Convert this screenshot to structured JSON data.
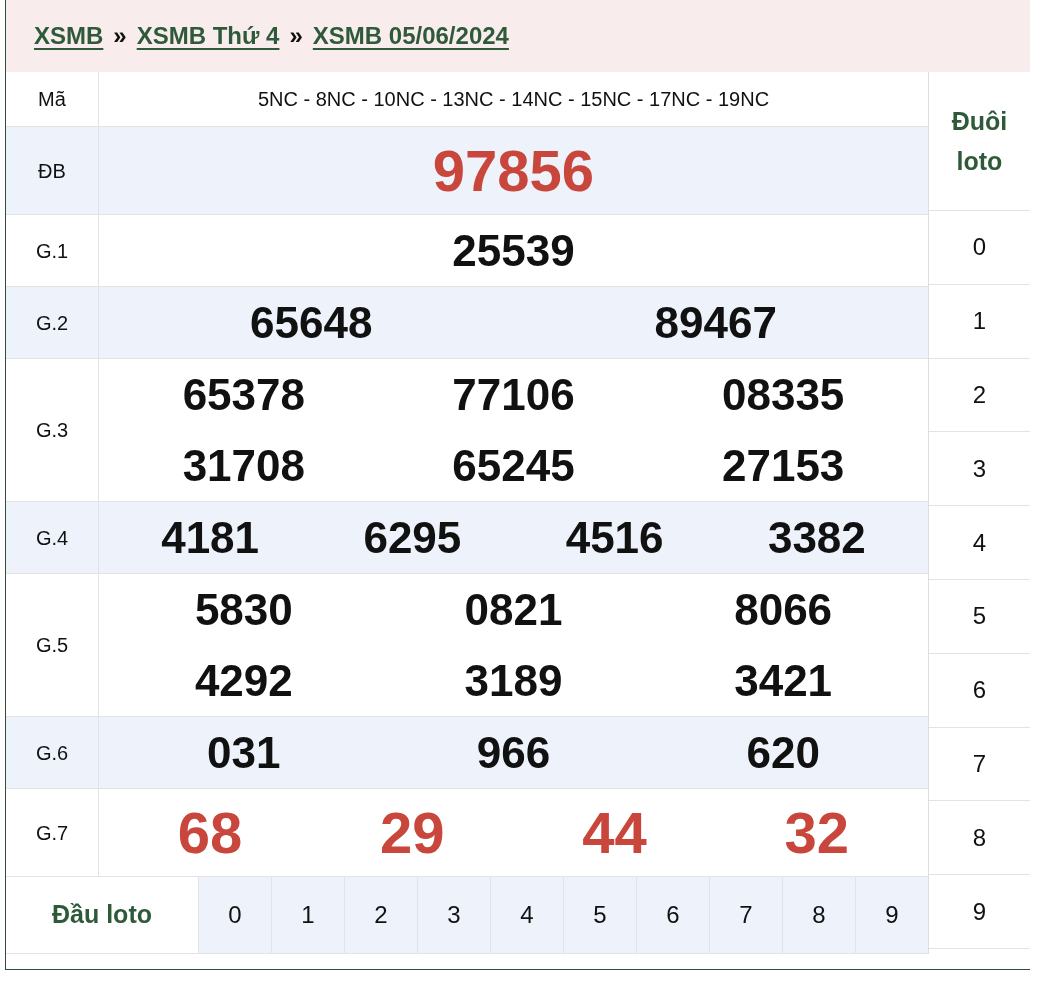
{
  "breadcrumb": [
    {
      "label": "XSMB"
    },
    {
      "label": "XSMB Thứ 4"
    },
    {
      "label": "XSMB 05/06/2024"
    }
  ],
  "separator": "»",
  "code_row": {
    "label": "Mã",
    "value": "5NC - 8NC - 10NC - 13NC - 14NC - 15NC - 17NC - 19NC"
  },
  "prizes": [
    {
      "label": "ĐB",
      "highlight": true,
      "numbers": [
        "97856"
      ]
    },
    {
      "label": "G.1",
      "highlight": false,
      "numbers": [
        "25539"
      ]
    },
    {
      "label": "G.2",
      "highlight": false,
      "numbers": [
        "65648",
        "89467"
      ]
    },
    {
      "label": "G.3",
      "highlight": false,
      "numbers": [
        "65378",
        "77106",
        "08335",
        "31708",
        "65245",
        "27153"
      ]
    },
    {
      "label": "G.4",
      "highlight": false,
      "numbers": [
        "4181",
        "6295",
        "4516",
        "3382"
      ]
    },
    {
      "label": "G.5",
      "highlight": false,
      "numbers": [
        "5830",
        "0821",
        "8066",
        "4292",
        "3189",
        "3421"
      ]
    },
    {
      "label": "G.6",
      "highlight": false,
      "numbers": [
        "031",
        "966",
        "620"
      ]
    },
    {
      "label": "G.7",
      "highlight": true,
      "numbers": [
        "68",
        "29",
        "44",
        "32"
      ]
    }
  ],
  "head_loto": {
    "label": "Đầu loto",
    "digits": [
      "0",
      "1",
      "2",
      "3",
      "4",
      "5",
      "6",
      "7",
      "8",
      "9"
    ]
  },
  "tail_loto": {
    "label": "Đuôi loto",
    "digits": [
      "0",
      "1",
      "2",
      "3",
      "4",
      "5",
      "6",
      "7",
      "8",
      "9"
    ]
  }
}
